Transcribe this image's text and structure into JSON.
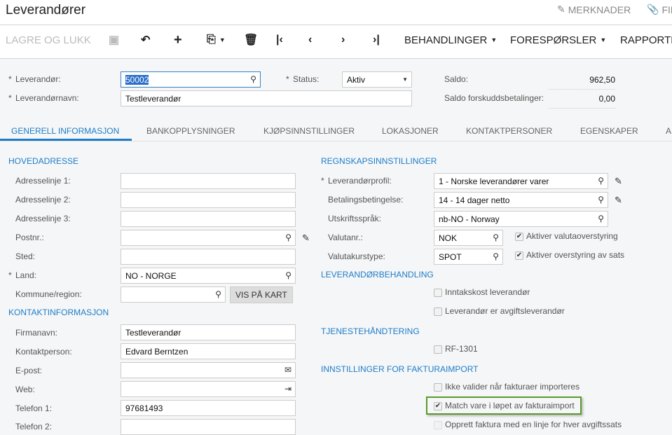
{
  "header": {
    "title": "Leverandører",
    "notes_label": "MERKNADER",
    "files_label": "FIL"
  },
  "toolbar": {
    "save_close": "LAGRE OG LUKK",
    "processes": "BEHANDLINGER",
    "inquiries": "FORESPØRSLER",
    "reports": "RAPPORTE"
  },
  "summary": {
    "vendor_label": "Leverandør:",
    "vendor_value": "50002",
    "name_label": "Leverandørnavn:",
    "name_value": "Testleverandør",
    "status_label": "Status:",
    "status_value": "Aktiv",
    "balance_label": "Saldo:",
    "balance_value": "962,50",
    "prepay_label": "Saldo forskuddsbetalinger:",
    "prepay_value": "0,00"
  },
  "tabs": [
    "GENERELL INFORMASJON",
    "BANKOPPLYSNINGER",
    "KJØPSINNSTILLINGER",
    "LOKASJONER",
    "KONTAKTPERSONER",
    "EGENSKAPER",
    "A"
  ],
  "address": {
    "title": "HOVEDADRESSE",
    "fields": [
      {
        "label": "Adresselinje 1:",
        "value": ""
      },
      {
        "label": "Adresselinje 2:",
        "value": ""
      },
      {
        "label": "Adresselinje 3:",
        "value": ""
      },
      {
        "label": "Postnr.:",
        "value": ""
      },
      {
        "label": "Sted:",
        "value": ""
      },
      {
        "label": "Land:",
        "value": "NO - NORGE"
      },
      {
        "label": "Kommune/region:",
        "value": ""
      }
    ],
    "map_button": "VIS PÅ KART"
  },
  "contact": {
    "title": "KONTAKTINFORMASJON",
    "fields": [
      {
        "label": "Firmanavn:",
        "value": "Testleverandør"
      },
      {
        "label": "Kontaktperson:",
        "value": "Edvard Berntzen"
      },
      {
        "label": "E-post:",
        "value": ""
      },
      {
        "label": "Web:",
        "value": ""
      },
      {
        "label": "Telefon 1:",
        "value": "97681493"
      },
      {
        "label": "Telefon 2:",
        "value": ""
      }
    ]
  },
  "accounting": {
    "title": "REGNSKAPSINNSTILLINGER",
    "fields": [
      {
        "label": "Leverandørprofil:",
        "value": "1 - Norske leverandører varer"
      },
      {
        "label": "Betalingsbetingelse:",
        "value": "14 - 14 dager netto"
      },
      {
        "label": "Utskriftsspråk:",
        "value": "nb-NO - Norway"
      },
      {
        "label": "Valutanr.:",
        "value": "NOK"
      },
      {
        "label": "Valutakurstype:",
        "value": "SPOT"
      }
    ],
    "checks": [
      {
        "label": "Aktiver valutaoverstyring",
        "checked": true
      },
      {
        "label": "Aktiver overstyring av sats",
        "checked": true
      }
    ]
  },
  "vendor_handling": {
    "title": "LEVERANDØRBEHANDLING",
    "checks": [
      {
        "label": "Inntakskost leverandør",
        "checked": false
      },
      {
        "label": "Leverandør er avgiftsleverandør",
        "checked": false
      }
    ]
  },
  "service": {
    "title": "TJENESTEHÅNDTERING",
    "checks": [
      {
        "label": "RF-1301",
        "checked": false
      }
    ]
  },
  "invoice_import": {
    "title": "INNSTILLINGER FOR FAKTURAIMPORT",
    "checks": [
      {
        "label": "Ikke valider når fakturaer importeres",
        "checked": false
      },
      {
        "label": "Match vare i løpet av fakturaimport",
        "checked": true
      },
      {
        "label": "Opprett faktura med en linje for hver avgiftssats",
        "checked": false
      }
    ]
  },
  "colors": {
    "accent": "#1d7dc9",
    "highlight": "#5a9a2a"
  }
}
